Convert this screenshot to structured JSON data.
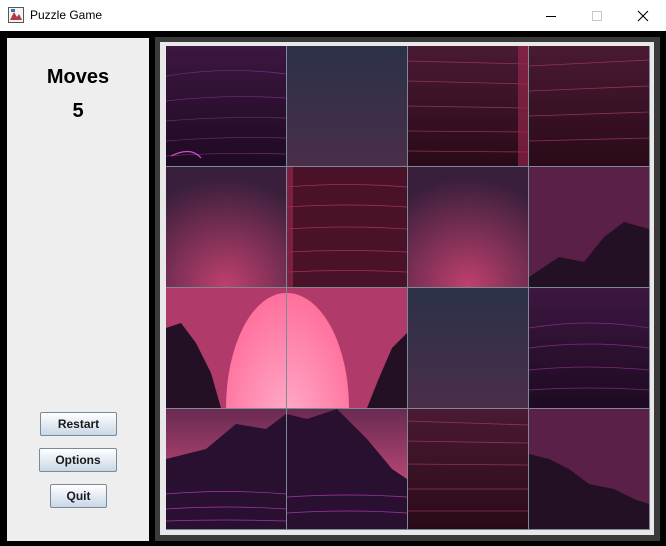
{
  "window": {
    "title": "Puzzle Game",
    "icon": "puzzle-app-icon",
    "controls": [
      "minimize-icon",
      "maximize-icon",
      "close-icon"
    ]
  },
  "sidebar": {
    "moves_label": "Moves",
    "moves_count": "5",
    "buttons": {
      "restart": "Restart",
      "options": "Options",
      "quit": "Quit"
    }
  },
  "board": {
    "rows": 4,
    "cols": 4,
    "image_theme": "synthwave pink sun and mountains",
    "colors": {
      "dark_purple": "#2a0f2b",
      "magenta": "#a0305a",
      "pink_sun": "#ff7aa8",
      "slate": "#3a3550",
      "grid_line": "#7c8a95"
    }
  }
}
